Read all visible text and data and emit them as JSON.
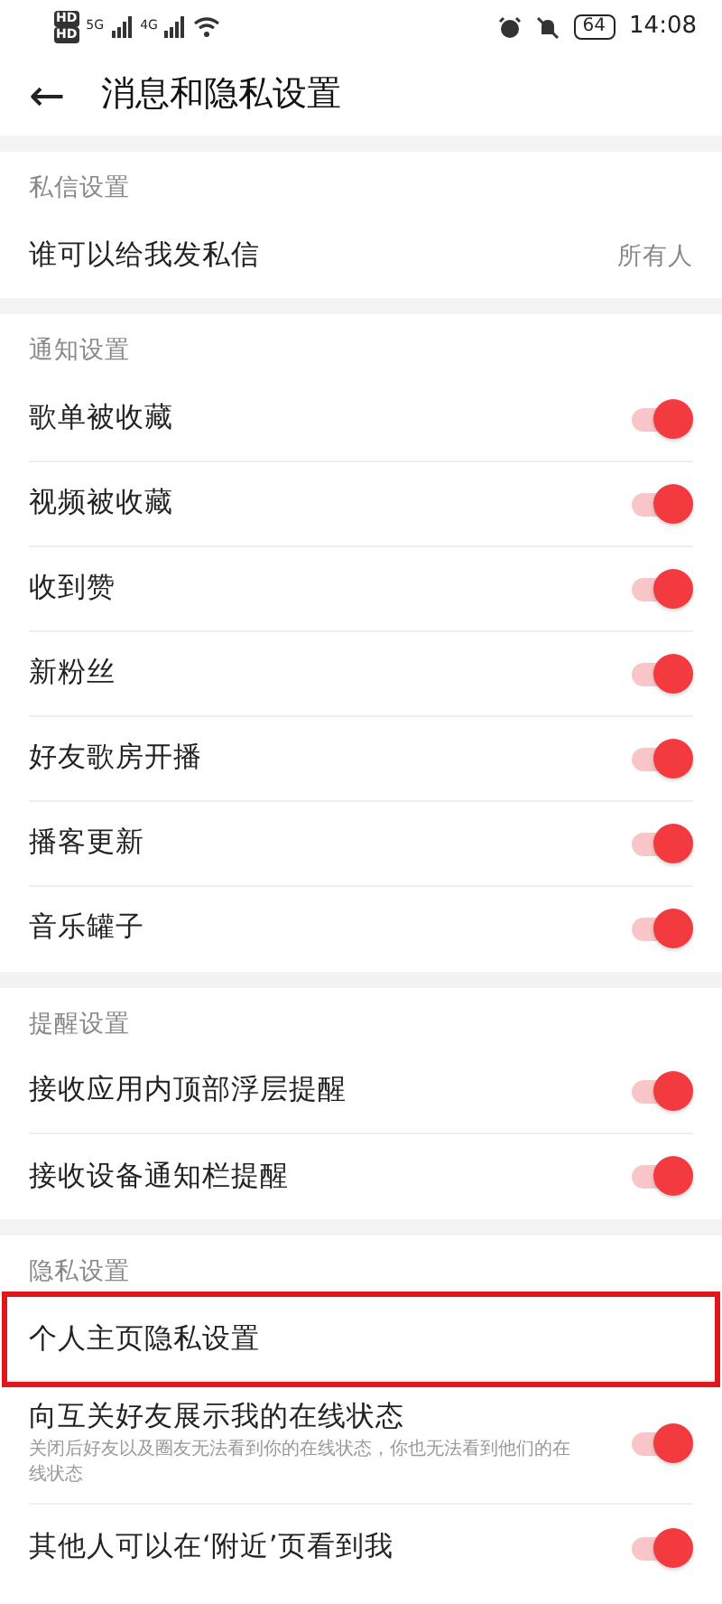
{
  "status_bar": {
    "sims": [
      "HD",
      "HD"
    ],
    "networks": [
      "5G",
      "4G"
    ],
    "battery": "64",
    "time": "14:08"
  },
  "header": {
    "back": "←",
    "title": "消息和隐私设置"
  },
  "sections": [
    {
      "title": "私信设置",
      "rows": [
        {
          "kind": "value",
          "label": "谁可以给我发私信",
          "value": "所有人"
        }
      ]
    },
    {
      "title": "通知设置",
      "rows": [
        {
          "kind": "toggle",
          "label": "歌单被收藏",
          "on": true
        },
        {
          "kind": "toggle",
          "label": "视频被收藏",
          "on": true
        },
        {
          "kind": "toggle",
          "label": "收到赞",
          "on": true
        },
        {
          "kind": "toggle",
          "label": "新粉丝",
          "on": true
        },
        {
          "kind": "toggle",
          "label": "好友歌房开播",
          "on": true
        },
        {
          "kind": "toggle",
          "label": "播客更新",
          "on": true
        },
        {
          "kind": "toggle",
          "label": "音乐罐子",
          "on": true
        }
      ]
    },
    {
      "title": "提醒设置",
      "rows": [
        {
          "kind": "toggle",
          "label": "接收应用内顶部浮层提醒",
          "on": true
        },
        {
          "kind": "toggle",
          "label": "接收设备通知栏提醒",
          "on": true
        }
      ]
    },
    {
      "title": "隐私设置",
      "rows": [
        {
          "kind": "link",
          "label": "个人主页隐私设置",
          "highlighted": true
        },
        {
          "kind": "toggle",
          "label": "向互关好友展示我的在线状态",
          "hint": "关闭后好友以及圈友无法看到你的在线状态，你也无法看到他们的在线状态",
          "on": true
        },
        {
          "kind": "toggle",
          "label": "其他人可以在‘附近’页看到我",
          "on": true
        }
      ]
    }
  ]
}
